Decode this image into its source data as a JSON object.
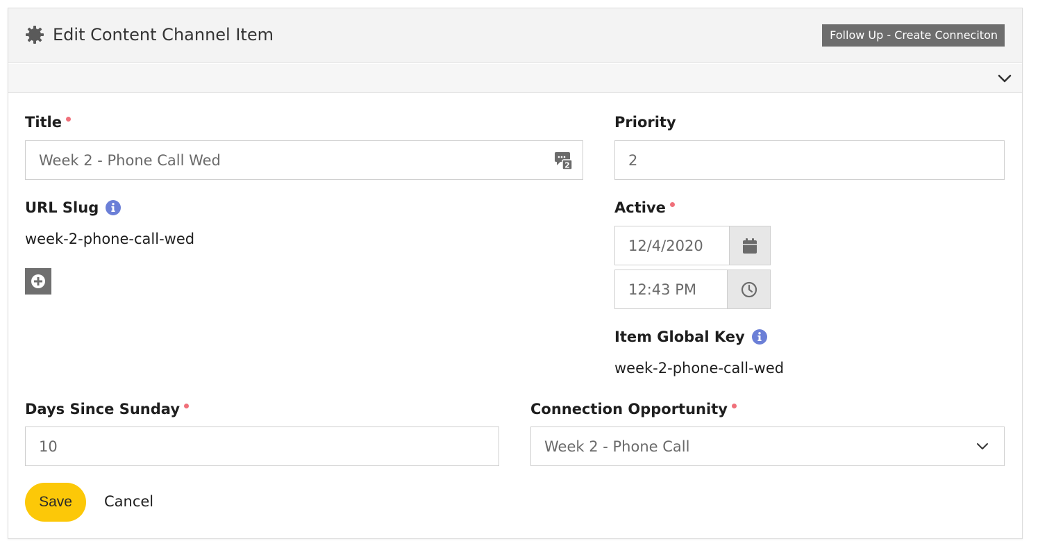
{
  "panel": {
    "title": "Edit Content Channel Item",
    "title_icon": "gear-icon",
    "badge_label": "Follow Up - Create Conneciton",
    "drawer_toggle_icon": "chevron-down-icon"
  },
  "form": {
    "title": {
      "label": "Title",
      "required": true,
      "value": "Week 2 - Phone Call Wed",
      "addon_icon": "sms-counter-icon",
      "addon_count": "2"
    },
    "priority": {
      "label": "Priority",
      "value": "2"
    },
    "url_slug": {
      "label": "URL Slug",
      "info_icon": "info-icon",
      "value": "week-2-phone-call-wed",
      "add_icon": "plus-circle-icon"
    },
    "active": {
      "label": "Active",
      "required": true,
      "date_value": "12/4/2020",
      "date_icon": "calendar-icon",
      "time_value": "12:43 PM",
      "time_icon": "clock-icon"
    },
    "item_global_key": {
      "label": "Item Global Key",
      "info_icon": "info-icon",
      "value": "week-2-phone-call-wed"
    },
    "days_since_sunday": {
      "label": "Days Since Sunday",
      "required": true,
      "value": "10"
    },
    "connection_opportunity": {
      "label": "Connection Opportunity",
      "required": true,
      "selected": "Week 2 - Phone Call"
    }
  },
  "actions": {
    "save_label": "Save",
    "cancel_label": "Cancel"
  },
  "colors": {
    "save_button": "#fcc808",
    "required_dot": "#f0707a",
    "info_icon": "#6b7fd7",
    "badge_bg": "#6d6d6d"
  }
}
